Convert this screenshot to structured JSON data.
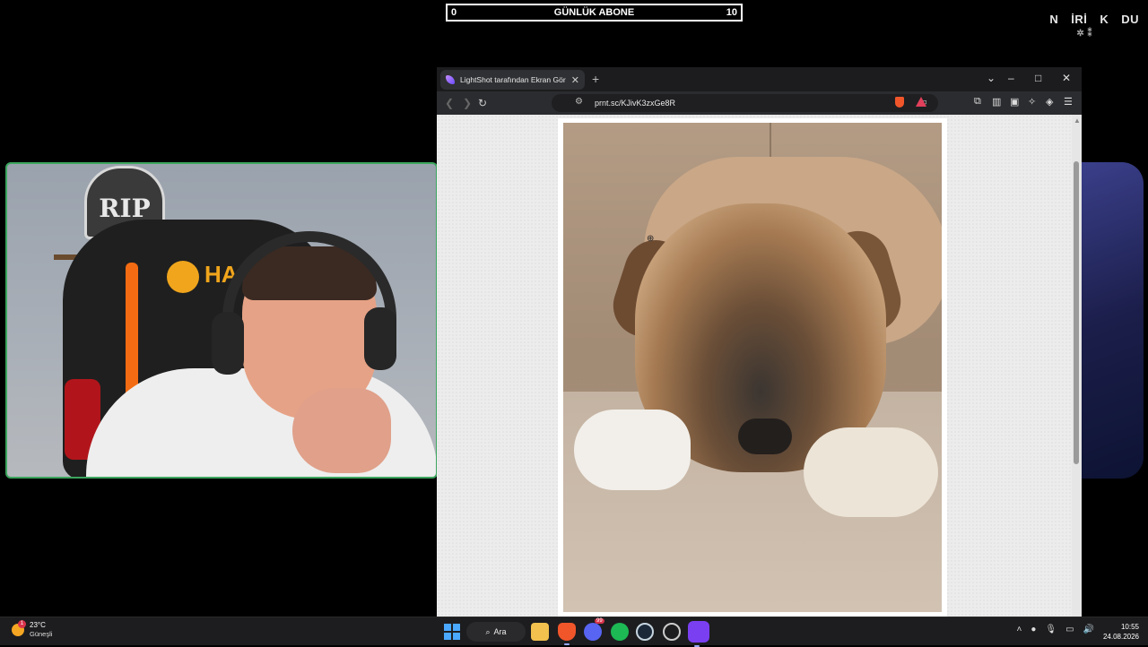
{
  "overlay": {
    "goal": {
      "left_value": "0",
      "title": "GÜNLÜK ABONE",
      "right_value": "10"
    },
    "brand_letters": [
      "N",
      "İRİ",
      "K",
      "DU"
    ]
  },
  "browser": {
    "tab_title": "LightShot tarafından Ekran Görü...",
    "url": "prnt.sc/KJivK3zxGe8R",
    "window_controls": {
      "dropdown": "⌄",
      "minimize": "–",
      "maximize": "□",
      "close": "✕"
    }
  },
  "taskbar": {
    "weather": {
      "temperature": "23°C",
      "condition": "Güneşli",
      "badge": "1"
    },
    "search_label": "Ara",
    "discord_badge": "99",
    "clock": {
      "time": "10:55",
      "date": "24.08.2026"
    }
  },
  "colors": {
    "webcam_border": "#3ba55d",
    "taskbar_bg": "#1d1d1f",
    "browser_chrome": "#2b2c2f"
  }
}
